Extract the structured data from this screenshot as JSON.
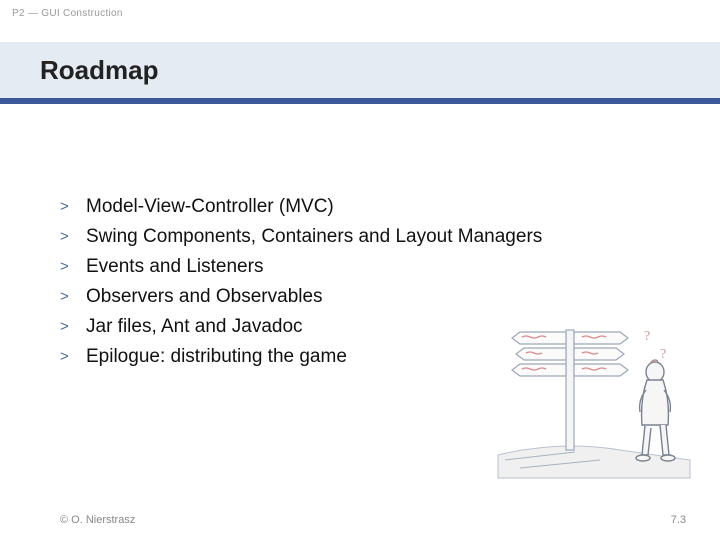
{
  "breadcrumb": "P2 — GUI Construction",
  "title": "Roadmap",
  "bullet_mark": ">",
  "bullets": [
    "Model-View-Controller (MVC)",
    "Swing Components, Containers and Layout Managers",
    "Events and Listeners",
    "Observers and Observables",
    "Jar files, Ant and Javadoc",
    "Epilogue: distributing the game"
  ],
  "footer": {
    "copyright": "© O. Nierstrasz",
    "page_num": "7.3"
  }
}
